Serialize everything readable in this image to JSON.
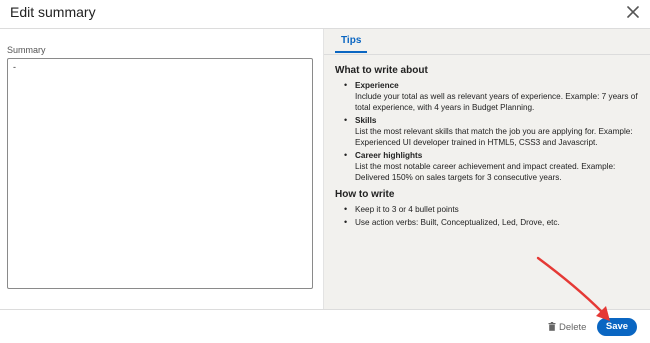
{
  "modal": {
    "title": "Edit summary"
  },
  "summary": {
    "label": "Summary",
    "value": "-"
  },
  "tips": {
    "tab_label": "Tips",
    "sections": [
      {
        "heading": "What to write about",
        "items": [
          {
            "title": "Experience",
            "text": "Include your total as well as relevant years of experience. Example: 7 years of total experience, with 4 years in Budget Planning."
          },
          {
            "title": "Skills",
            "text": "List the most relevant skills that match the job you are applying for. Example: Experienced UI developer trained in HTML5, CSS3 and Javascript."
          },
          {
            "title": "Career highlights",
            "text": "List the most notable career achievement and impact created. Example: Delivered 150% on sales targets for 3 consecutive years."
          }
        ]
      },
      {
        "heading": "How to write",
        "items": [
          {
            "text": "Keep it to 3 or 4 bullet points"
          },
          {
            "text": "Use action verbs: Built, Conceptualized, Led, Drove, etc."
          }
        ]
      }
    ]
  },
  "footer": {
    "delete_label": "Delete",
    "save_label": "Save"
  },
  "colors": {
    "accent": "#0a66c2",
    "annotation_arrow": "#e53935",
    "tips_background": "#f2f1ee"
  },
  "icons": {
    "close": "close-icon",
    "delete": "trash-icon"
  }
}
